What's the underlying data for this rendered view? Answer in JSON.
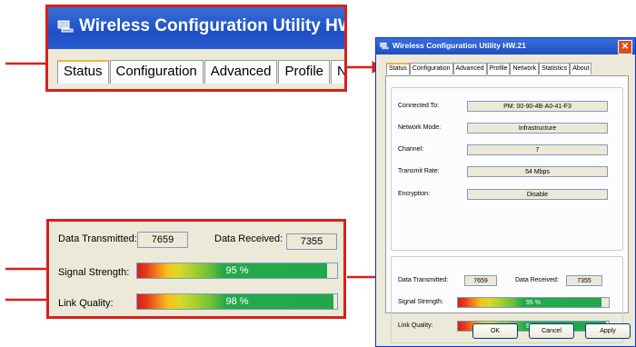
{
  "app": {
    "title": "Wireless Configuration Utility HW.21"
  },
  "tabs": [
    "Status",
    "Configuration",
    "Advanced",
    "Profile",
    "Network",
    "Statistics",
    "About"
  ],
  "zoom_tabs": [
    "Status",
    "Configuration",
    "Advanced",
    "Profile",
    "Netw"
  ],
  "status": {
    "connected_to_label": "Connected To:",
    "connected_to": "PM: 00-90-4B-A0-41-F3",
    "network_mode_label": "Network Mode:",
    "network_mode": "Infrastructure",
    "channel_label": "Channel:",
    "channel": "7",
    "transmit_rate_label": "Transmit Rate:",
    "transmit_rate": "54 Mbps",
    "encryption_label": "Encryption:",
    "encryption": "Disable"
  },
  "traffic": {
    "tx_label": "Data Transmitted:",
    "tx": "7659",
    "rx_label": "Data Received:",
    "rx": "7355",
    "signal_label": "Signal Strength:",
    "signal_text": "95 %",
    "signal_fraction": 0.95,
    "link_label": "Link Quality:",
    "link_text": "98 %",
    "link_fraction": 0.98
  },
  "buttons": {
    "ok": "OK",
    "cancel": "Cancel",
    "apply": "Apply"
  },
  "colors": {
    "callout": "#d8201c",
    "titlebar": "#1d4fc2",
    "bar_green": "#21a84a"
  }
}
